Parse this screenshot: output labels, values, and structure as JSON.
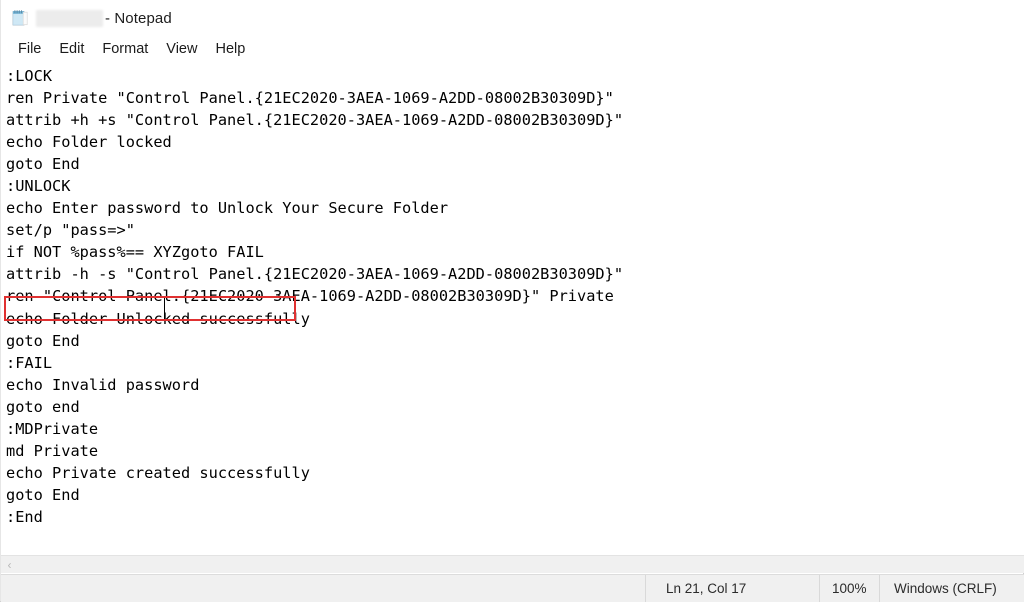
{
  "window": {
    "app_name": "Notepad",
    "title_suffix": "- Notepad",
    "title_redacted": "",
    "icon": "notepad-icon"
  },
  "menubar": {
    "items": [
      {
        "label": "File"
      },
      {
        "label": "Edit"
      },
      {
        "label": "Format"
      },
      {
        "label": "View"
      },
      {
        "label": "Help"
      }
    ]
  },
  "editor": {
    "lines": [
      ":LOCK",
      "ren Private \"Control Panel.{21EC2020-3AEA-1069-A2DD-08002B30309D}\"",
      "attrib +h +s \"Control Panel.{21EC2020-3AEA-1069-A2DD-08002B30309D}\"",
      "echo Folder locked",
      "goto End",
      ":UNLOCK",
      "echo Enter password to Unlock Your Secure Folder",
      "set/p \"pass=>\"",
      "if NOT %pass%== XYZgoto FAIL",
      "attrib -h -s \"Control Panel.{21EC2020-3AEA-1069-A2DD-08002B30309D}\"",
      "ren \"Control Panel.{21EC2020-3AEA-1069-A2DD-08002B30309D}\" Private",
      "echo Folder Unlocked successfully",
      "goto End",
      ":FAIL",
      "echo Invalid password",
      "goto end",
      ":MDPrivate",
      "md Private",
      "echo Private created successfully",
      "goto End",
      ":End"
    ],
    "highlight": {
      "line_index": 8,
      "text": "if NOT %pass%== XYZgoto FAIL",
      "color": "#e03131"
    },
    "caret": {
      "line": 21,
      "column": 17
    }
  },
  "scrollbar": {
    "left_arrow": "‹",
    "orientation": "horizontal"
  },
  "statusbar": {
    "position": "Ln 21, Col 17",
    "zoom": "100%",
    "line_ending": "Windows (CRLF)"
  }
}
